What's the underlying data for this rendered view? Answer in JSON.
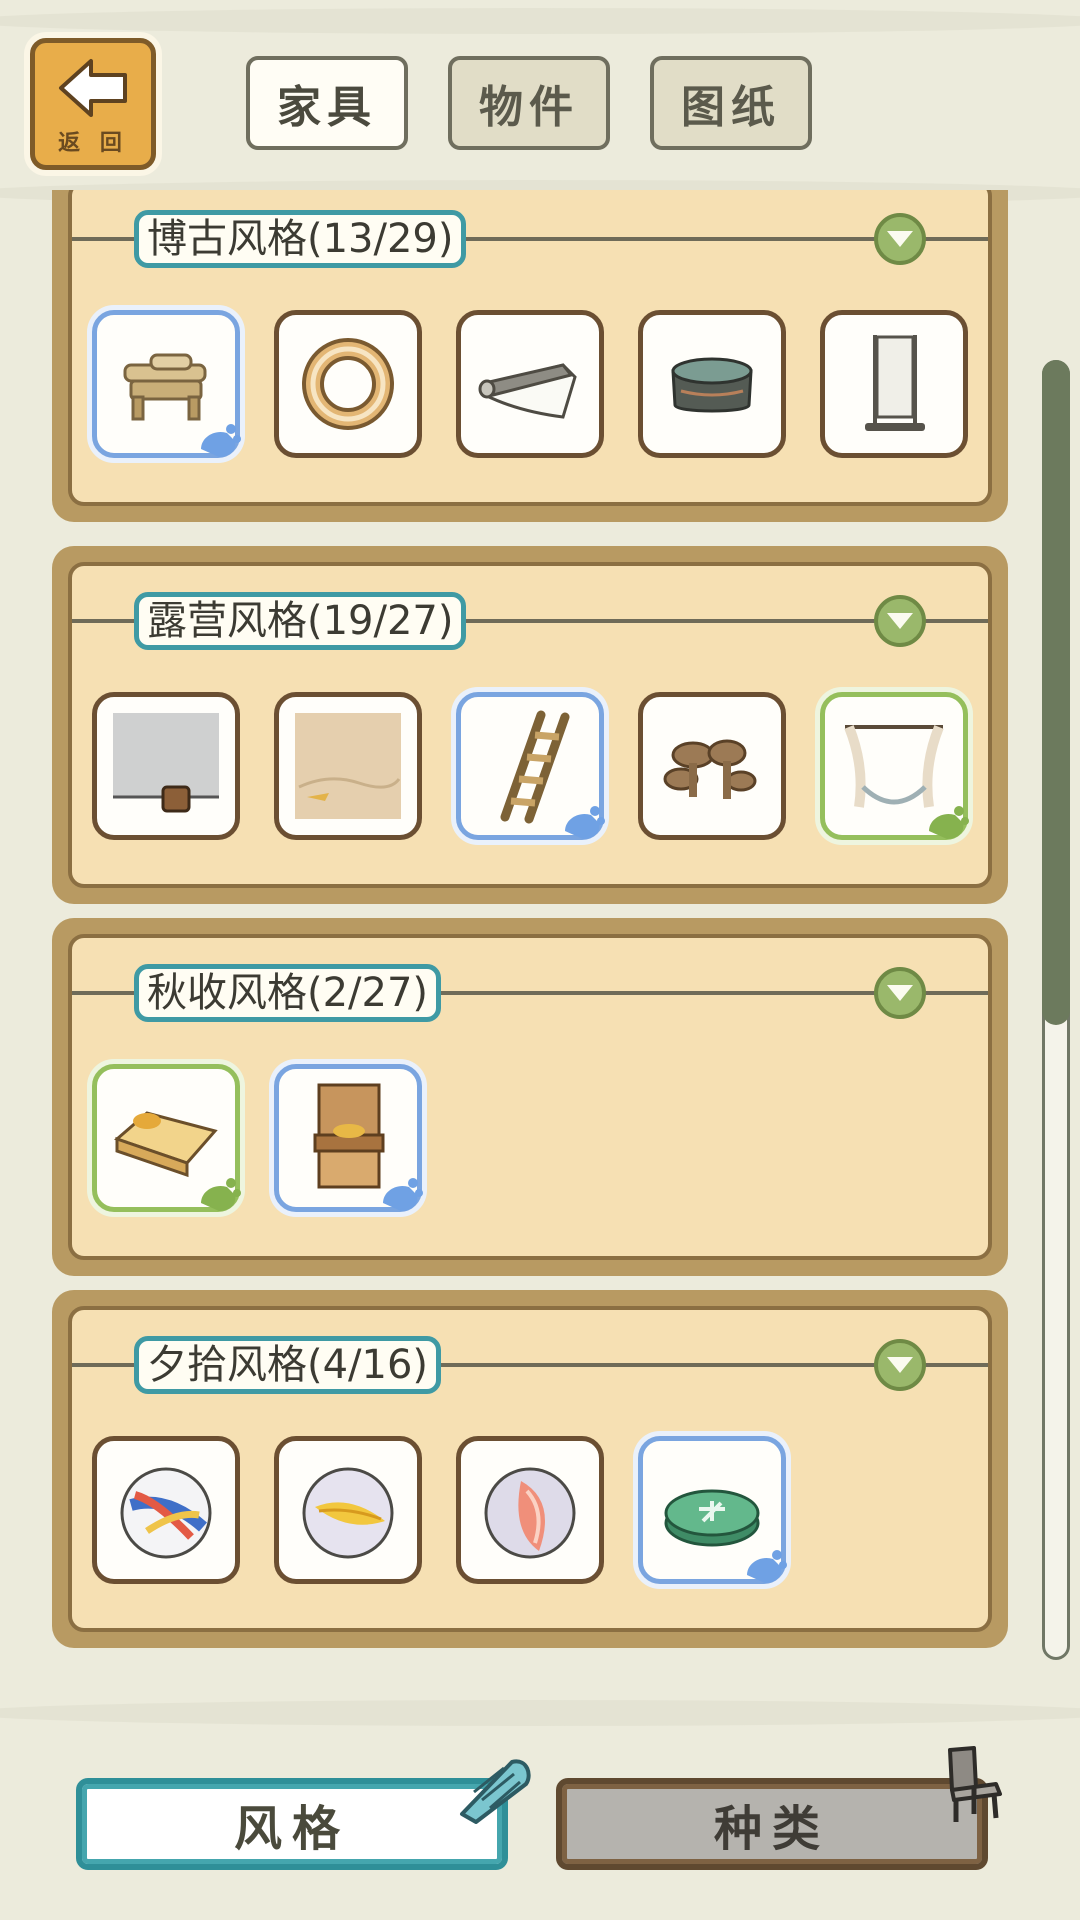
{
  "header": {
    "back_label": "返 回",
    "tabs": [
      {
        "label": "家具",
        "active": true
      },
      {
        "label": "物件",
        "active": false
      },
      {
        "label": "图纸",
        "active": false
      }
    ]
  },
  "sections": [
    {
      "title": "博古风格(13/29)",
      "items": [
        {
          "icon": "wooden-bench-icon",
          "highlight": "blue"
        },
        {
          "icon": "wreath-ring-icon",
          "highlight": "none"
        },
        {
          "icon": "scroll-painting-icon",
          "highlight": "none"
        },
        {
          "icon": "stone-basin-icon",
          "highlight": "none"
        },
        {
          "icon": "hanging-scroll-stand-icon",
          "highlight": "none"
        }
      ]
    },
    {
      "title": "露营风格(19/27)",
      "items": [
        {
          "icon": "rock-wall-bucket-icon",
          "highlight": "none"
        },
        {
          "icon": "sand-ground-icon",
          "highlight": "none"
        },
        {
          "icon": "wooden-ladder-icon",
          "highlight": "blue"
        },
        {
          "icon": "mushroom-cluster-icon",
          "highlight": "none"
        },
        {
          "icon": "tent-hammock-icon",
          "highlight": "green"
        }
      ]
    },
    {
      "title": "秋收风格(2/27)",
      "items": [
        {
          "icon": "autumn-bed-icon",
          "highlight": "green"
        },
        {
          "icon": "wooden-cabinet-icon",
          "highlight": "blue"
        }
      ]
    },
    {
      "title": "夕拾风格(4/16)",
      "items": [
        {
          "icon": "marble-blue-red-icon",
          "highlight": "none"
        },
        {
          "icon": "marble-yellow-icon",
          "highlight": "none"
        },
        {
          "icon": "marble-pink-icon",
          "highlight": "none"
        },
        {
          "icon": "green-token-icon",
          "highlight": "blue"
        }
      ]
    }
  ],
  "bottom_tabs": [
    {
      "label": "风格",
      "active": true
    },
    {
      "label": "种类",
      "active": false
    }
  ],
  "colors": {
    "accent_teal": "#3f9aa4",
    "owned_blue": "#7aa5e0",
    "owned_green": "#95bf5c",
    "panel": "#f6e0b3"
  }
}
